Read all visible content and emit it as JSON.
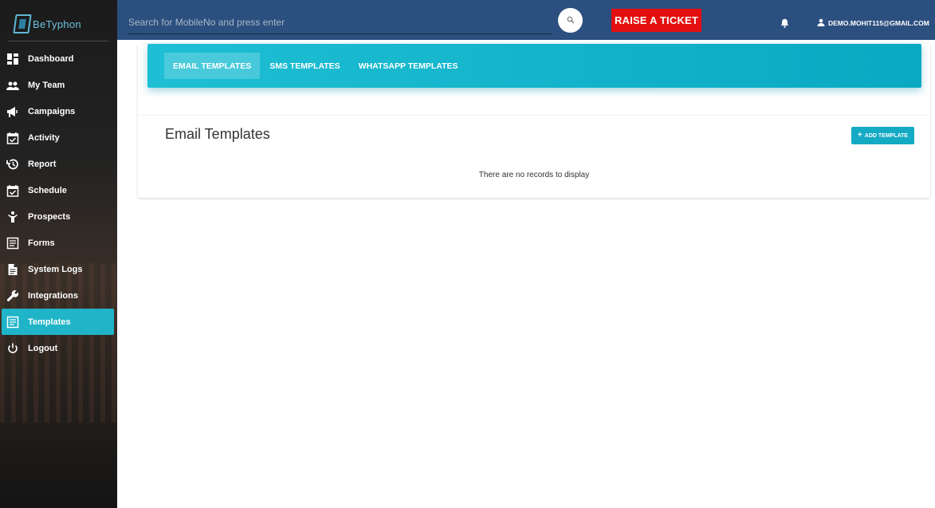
{
  "brand": {
    "name": "BeTyphon"
  },
  "sidebar": {
    "items": [
      {
        "label": "Dashboard",
        "icon": "dashboard-icon"
      },
      {
        "label": "My Team",
        "icon": "team-icon"
      },
      {
        "label": "Campaigns",
        "icon": "megaphone-icon"
      },
      {
        "label": "Activity",
        "icon": "calendar-check-icon"
      },
      {
        "label": "Report",
        "icon": "history-icon"
      },
      {
        "label": "Schedule",
        "icon": "calendar-check-icon"
      },
      {
        "label": "Prospects",
        "icon": "person-icon"
      },
      {
        "label": "Forms",
        "icon": "form-icon"
      },
      {
        "label": "System Logs",
        "icon": "document-icon"
      },
      {
        "label": "Integrations",
        "icon": "wrench-icon"
      },
      {
        "label": "Templates",
        "icon": "template-icon",
        "active": true
      },
      {
        "label": "Logout",
        "icon": "power-icon"
      }
    ]
  },
  "header": {
    "search_placeholder": "Search for MobileNo and press enter",
    "ticket_label": "RAISE A TICKET",
    "user_email": "DEMO.MOHIT115@GMAIL.COM"
  },
  "tabs": [
    {
      "label": "EMAIL TEMPLATES",
      "active": true
    },
    {
      "label": "SMS TEMPLATES"
    },
    {
      "label": "WHATSAPP TEMPLATES"
    }
  ],
  "main": {
    "title": "Email Templates",
    "add_button": "ADD TEMPLATE",
    "empty_message": "There are no records to display"
  },
  "colors": {
    "header": "#2b4f7e",
    "accent": "#1fb4c8",
    "ticket": "#e40f0f"
  }
}
